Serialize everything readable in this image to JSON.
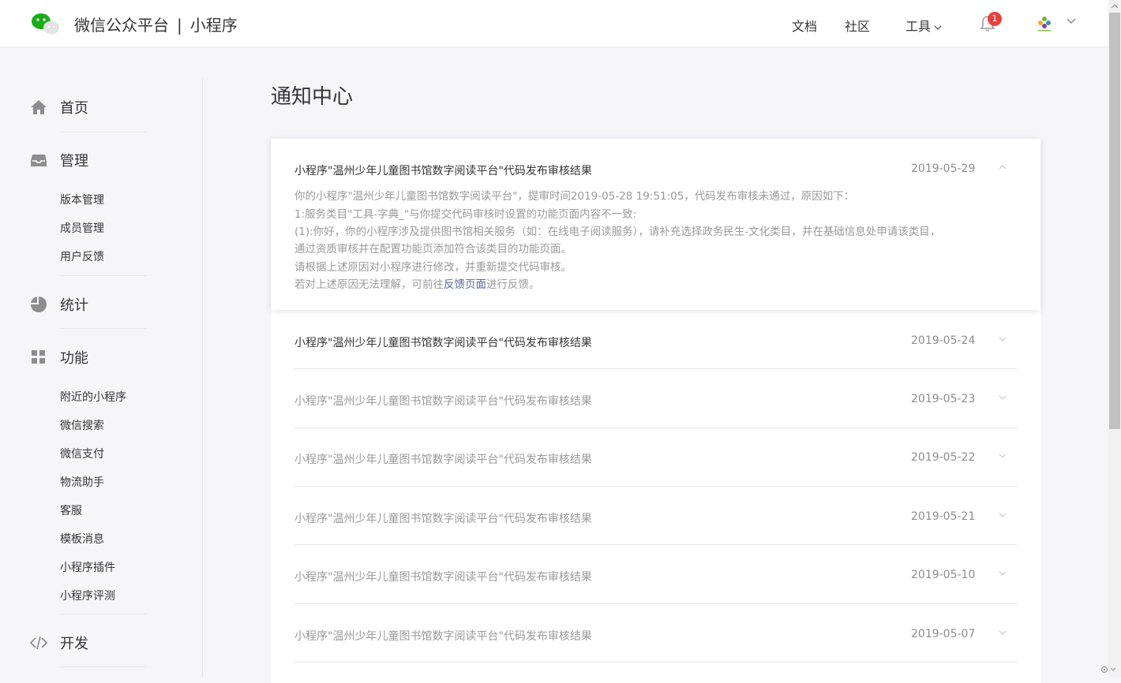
{
  "header": {
    "brand_name": "微信公众平台",
    "brand_sep": "|",
    "brand_product": "小程序",
    "nav": {
      "docs": "文档",
      "community": "社区",
      "tools": "工具"
    },
    "notification_count": "1"
  },
  "sidebar": {
    "home": "首页",
    "manage": "管理",
    "manage_items": [
      "版本管理",
      "成员管理",
      "用户反馈"
    ],
    "stats": "统计",
    "features": "功能",
    "feature_items": [
      "附近的小程序",
      "微信搜索",
      "微信支付",
      "物流助手",
      "客服",
      "模板消息",
      "小程序插件",
      "小程序评测"
    ],
    "develop": "开发"
  },
  "main": {
    "title": "通知中心",
    "expanded": {
      "title": "小程序\"温州少年儿童图书馆数字阅读平台\"代码发布审核结果",
      "date": "2019-05-29",
      "lines": [
        "你的小程序\"温州少年儿童图书馆数字阅读平台\"，提审时间2019-05-28 19:51:05，代码发布审核未通过，原因如下：",
        "1:服务类目\"工具-字典_\"与你提交代码审核时设置的功能页面内容不一致:",
        "(1):你好，你的小程序涉及提供图书馆相关服务（如：在线电子阅读服务），请补充选择政务民生-文化类目，并在基础信息处申请该类目，",
        "通过资质审核并在配置功能页添加符合该类目的功能页面。",
        "请根据上述原因对小程序进行修改，并重新提交代码审核。"
      ],
      "last_prefix": "若对上述原因无法理解，可前往",
      "last_link": "反馈页面",
      "last_suffix": "进行反馈。"
    },
    "notifications": [
      {
        "title": "小程序\"温州少年儿童图书馆数字阅读平台\"代码发布审核结果",
        "date": "2019-05-24",
        "read": false
      },
      {
        "title": "小程序\"温州少年儿童图书馆数字阅读平台\"代码发布审核结果",
        "date": "2019-05-23",
        "read": true
      },
      {
        "title": "小程序\"温州少年儿童图书馆数字阅读平台\"代码发布审核结果",
        "date": "2019-05-22",
        "read": true
      },
      {
        "title": "小程序\"温州少年儿童图书馆数字阅读平台\"代码发布审核结果",
        "date": "2019-05-21",
        "read": true
      },
      {
        "title": "小程序\"温州少年儿童图书馆数字阅读平台\"代码发布审核结果",
        "date": "2019-05-10",
        "read": true
      },
      {
        "title": "小程序\"温州少年儿童图书馆数字阅读平台\"代码发布审核结果",
        "date": "2019-05-07",
        "read": true
      }
    ]
  },
  "colors": {
    "brand_green": "#1aad19",
    "badge_red": "#e64340",
    "link_blue": "#576b95",
    "read_gray": "#9a9a9a"
  }
}
